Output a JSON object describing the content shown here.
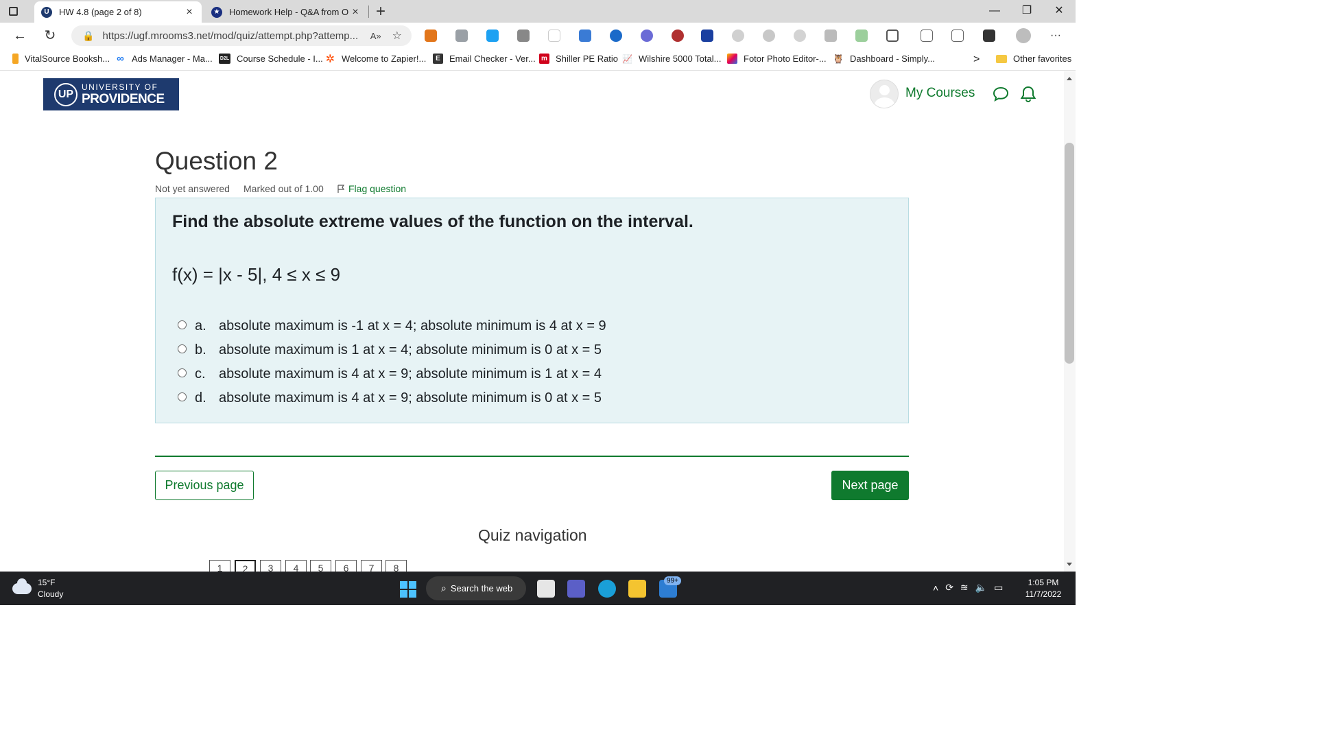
{
  "browser": {
    "tabs": [
      {
        "title": "HW 4.8 (page 2 of 8)",
        "close": "×"
      },
      {
        "title": "Homework Help - Q&A from On",
        "close": "×"
      }
    ],
    "new_tab": "+",
    "window_controls": {
      "minimize": "—",
      "restore": "❐",
      "close": "✕"
    },
    "url": "https://ugf.mrooms3.net/mod/quiz/attempt.php?attemp...",
    "read_aloud": "A»",
    "favorites": [
      {
        "label": "VitalSource Booksh...",
        "icon": "vitalsource-icon",
        "color": "#f5a623"
      },
      {
        "label": "Ads Manager - Ma...",
        "icon": "meta-icon",
        "color": "#1877f2"
      },
      {
        "label": "Course Schedule - I...",
        "icon": "d2l-icon",
        "color": "#222222"
      },
      {
        "label": "Welcome to Zapier!...",
        "icon": "zapier-icon",
        "color": "#ff4a00"
      },
      {
        "label": "Email Checker - Ver...",
        "icon": "email-checker-icon",
        "color": "#333333"
      },
      {
        "label": "Shiller PE Ratio",
        "icon": "multpl-icon",
        "color": "#d0021b"
      },
      {
        "label": "Wilshire 5000 Total...",
        "icon": "chart-icon",
        "color": "#7a9cc6"
      },
      {
        "label": "Fotor Photo Editor-...",
        "icon": "fotor-icon",
        "color": "#f7c600"
      },
      {
        "label": "Dashboard - Simply...",
        "icon": "simply-icon",
        "color": "#6b4f2a"
      }
    ],
    "favorites_more": ">",
    "other_favorites": "Other favorites"
  },
  "site": {
    "logo_line1": "UNIVERSITY OF",
    "logo_line2": "PROVIDENCE",
    "logo_mark": "UP",
    "my_courses": "My Courses"
  },
  "question": {
    "title": "Question 2",
    "status": "Not yet answered",
    "marked": "Marked out of 1.00",
    "flag": "Flag question",
    "prompt": "Find the absolute extreme values of the function on the interval.",
    "function": "f(x) = |x - 5|, 4 ≤ x ≤ 9",
    "options": [
      {
        "letter": "a.",
        "text": "absolute maximum is -1 at x = 4; absolute minimum is 4 at x = 9"
      },
      {
        "letter": "b.",
        "text": "absolute maximum is 1 at x = 4; absolute minimum is 0 at x = 5"
      },
      {
        "letter": "c.",
        "text": "absolute maximum is 4 at x = 9; absolute minimum is 1 at x = 4"
      },
      {
        "letter": "d.",
        "text": "absolute maximum is 4 at x = 9; absolute minimum is 0 at x = 5"
      }
    ]
  },
  "navigation": {
    "previous": "Previous page",
    "next": "Next page",
    "quiz_nav_title": "Quiz navigation",
    "pages": [
      "1",
      "2",
      "3",
      "4",
      "5",
      "6",
      "7",
      "8"
    ],
    "current_page": "2"
  },
  "taskbar": {
    "temperature": "15°F",
    "weather": "Cloudy",
    "search": "Search the web",
    "mail_badge": "99+",
    "time": "1:05 PM",
    "date": "11/7/2022"
  },
  "colors": {
    "accent_green": "#0f7a2e",
    "question_bg": "#e7f3f5",
    "logo_navy": "#1e3a6e"
  }
}
